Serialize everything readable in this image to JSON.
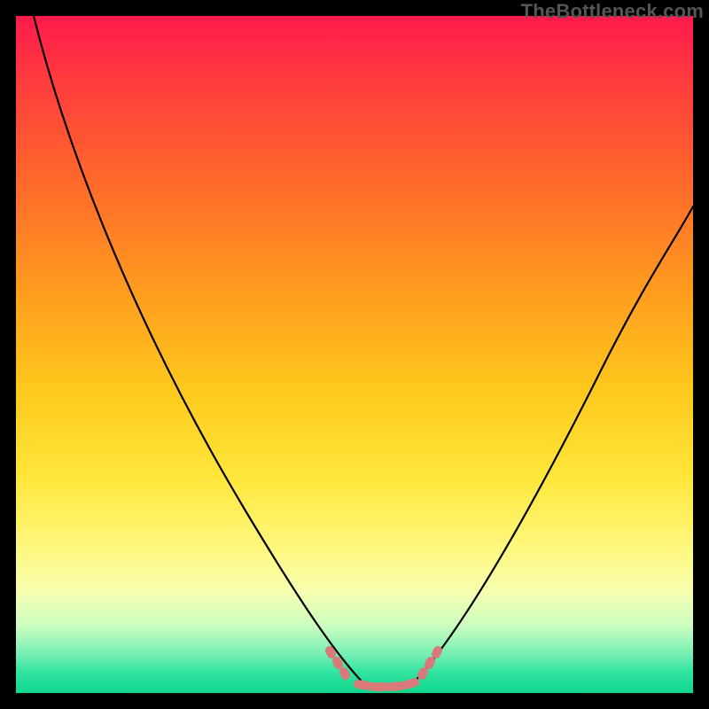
{
  "watermark": "TheBottleneck.com",
  "colors": {
    "frame_bg": "#000000",
    "gradient_stops": [
      "#ff1a4d",
      "#ff3d3d",
      "#ff6a2a",
      "#ff9a1f",
      "#ffc81c",
      "#ffe63a",
      "#fff77a",
      "#f7ffb0",
      "#ccffc0",
      "#7cf0b4",
      "#2fe3a0",
      "#10d68c"
    ],
    "curve_stroke": "#000000",
    "marker_fill": "#d87a7a"
  },
  "chart_data": {
    "type": "line",
    "title": "",
    "xlabel": "",
    "ylabel": "",
    "xlim": [
      0,
      100
    ],
    "ylim": [
      0,
      100
    ],
    "series": [
      {
        "name": "left_limb",
        "x": [
          3,
          10,
          20,
          30,
          40,
          45,
          48,
          52
        ],
        "values": [
          100,
          80,
          55,
          35,
          15,
          6,
          2,
          0
        ]
      },
      {
        "name": "floor",
        "x": [
          52,
          58
        ],
        "values": [
          0,
          0
        ]
      },
      {
        "name": "right_limb",
        "x": [
          58,
          62,
          70,
          80,
          90,
          100
        ],
        "values": [
          0,
          4,
          18,
          38,
          58,
          72
        ]
      }
    ],
    "markers": {
      "name": "highlight_points",
      "color": "#d87a7a",
      "points_xy": [
        [
          46,
          4.5
        ],
        [
          47,
          3.0
        ],
        [
          48,
          1.5
        ],
        [
          50,
          0.5
        ],
        [
          52,
          0
        ],
        [
          54,
          0
        ],
        [
          56,
          0
        ],
        [
          58,
          0.5
        ],
        [
          59,
          1.5
        ],
        [
          60,
          3.0
        ],
        [
          61,
          4.5
        ]
      ]
    }
  }
}
